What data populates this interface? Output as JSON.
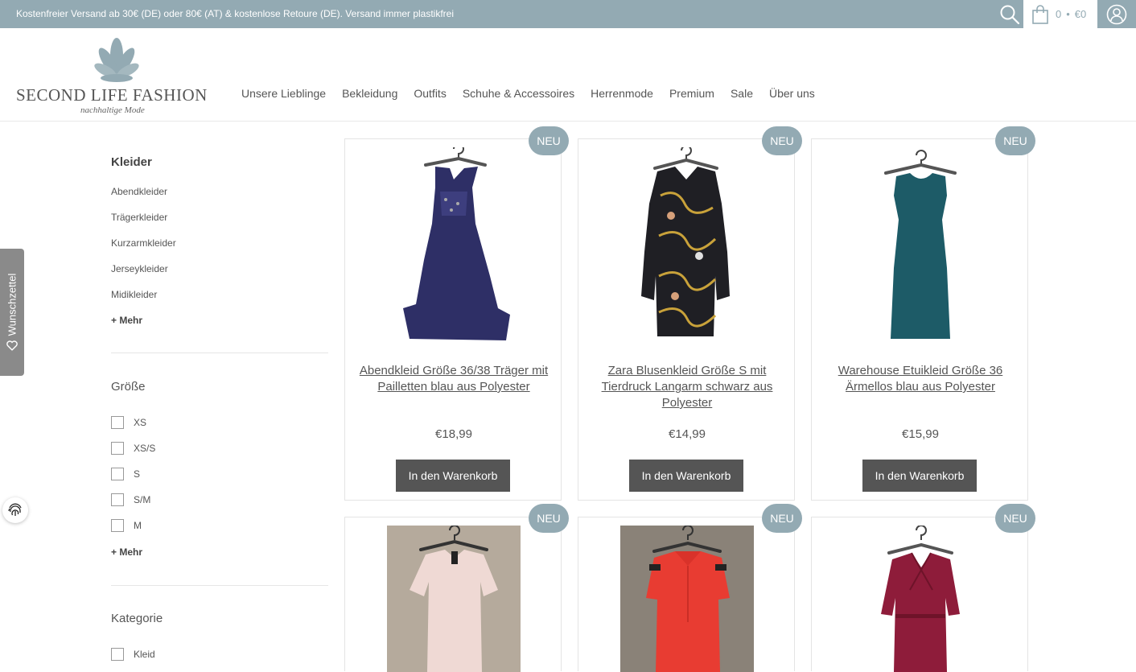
{
  "topbar": {
    "shipping_text": "Kostenfreier Versand ab 30€ (DE) oder 80€ (AT) & kostenlose Retoure (DE). Versand immer plastikfrei",
    "cart_count": "0",
    "cart_separator": "•",
    "cart_total": "€0"
  },
  "logo": {
    "name": "SECOND LIFE FASHION",
    "tagline": "nachhaltige Mode"
  },
  "nav": {
    "items": [
      "Unsere Lieblinge",
      "Bekleidung",
      "Outfits",
      "Schuhe & Accessoires",
      "Herrenmode",
      "Premium",
      "Sale",
      "Über uns"
    ]
  },
  "wishlist": {
    "label": "Wunschzettel"
  },
  "sidebar": {
    "category_title": "Kleider",
    "category_links": [
      "Abendkleider",
      "Trägerkleider",
      "Kurzarmkleider",
      "Jerseykleider",
      "Midikleider"
    ],
    "more_label": "+ Mehr",
    "size_heading": "Größe",
    "sizes": [
      "XS",
      "XS/S",
      "S",
      "S/M",
      "M"
    ],
    "size_more_label": "+ Mehr",
    "kategorie_heading": "Kategorie",
    "kategorie_options": [
      "Kleid"
    ]
  },
  "products": [
    {
      "badge": "NEU",
      "title": "Abendkleid Größe 36/38 Träger mit Pailletten blau aus Polyester",
      "price": "€18,99",
      "button": "In den Warenkorb",
      "color": "#2e2f66"
    },
    {
      "badge": "NEU",
      "title": "Zara Blusenkleid Größe S mit Tierdruck Langarm schwarz aus Polyester",
      "price": "€14,99",
      "button": "In den Warenkorb",
      "color": "#1f1f24"
    },
    {
      "badge": "NEU",
      "title": "Warehouse Etuikleid Größe 36 Ärmellos blau aus Polyester",
      "price": "€15,99",
      "button": "In den Warenkorb",
      "color": "#1d5b67"
    },
    {
      "badge": "NEU",
      "color": "#efd9d4"
    },
    {
      "badge": "NEU",
      "color": "#e83c32"
    },
    {
      "badge": "NEU",
      "color": "#8e1c3a"
    }
  ],
  "colors": {
    "accent": "#93aab3",
    "button": "#555555"
  }
}
